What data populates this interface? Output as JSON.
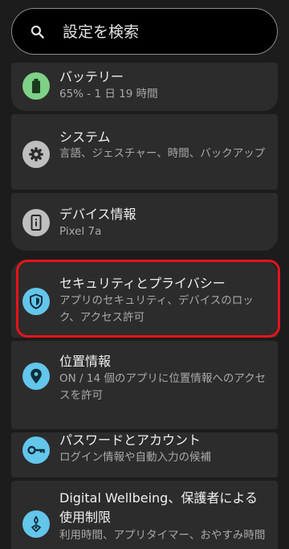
{
  "search": {
    "placeholder": "設定を検索",
    "icon": "search-icon"
  },
  "items": [
    {
      "id": "battery",
      "title": "バッテリー",
      "subtitle": "65% - 1 日 19 時間",
      "icon": "battery-icon",
      "icon_color": "#7ed187"
    },
    {
      "id": "system",
      "title": "システム",
      "subtitle": "言語、ジェスチャー、時間、バックアップ",
      "icon": "gear-icon",
      "icon_color": "#bfbfbf"
    },
    {
      "id": "device-info",
      "title": "デバイス情報",
      "subtitle": "Pixel 7a",
      "icon": "phone-info-icon",
      "icon_color": "#bfbfbf"
    },
    {
      "id": "security-privacy",
      "title": "セキュリティとプライバシー",
      "subtitle": "アプリのセキュリティ、デバイスのロック、アクセス許可",
      "icon": "shield-icon",
      "icon_color": "#63c6ea",
      "highlighted": true
    },
    {
      "id": "location",
      "title": "位置情報",
      "subtitle": "ON / 14 個のアプリに位置情報へのアクセスを許可",
      "icon": "location-pin-icon",
      "icon_color": "#63c6ea"
    },
    {
      "id": "passwords-accounts",
      "title": "パスワードとアカウント",
      "subtitle": "ログイン情報や自動入力の候補",
      "icon": "key-icon",
      "icon_color": "#63c6ea"
    },
    {
      "id": "digital-wellbeing",
      "title": "Digital Wellbeing、保護者による使用制限",
      "subtitle": "利用時間、アプリタイマー、おやすみ時間",
      "icon": "wellbeing-icon",
      "icon_color": "#63c6ea"
    }
  ],
  "colors": {
    "background": "#1c1c1c",
    "card": "#2c2c2c",
    "highlight_border": "#e8131c"
  }
}
